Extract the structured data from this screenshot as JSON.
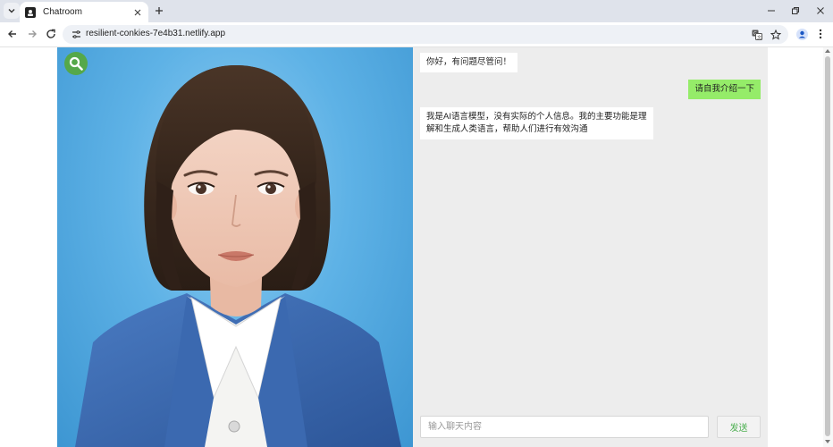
{
  "browser": {
    "tab_title": "Chatroom",
    "url": "resilient-conkies-7e4b31.netlify.app",
    "icons": [
      "tab-search-icon",
      "favicon-icon",
      "close-icon",
      "plus-icon",
      "minimize-icon",
      "restore-icon",
      "close-window-icon",
      "back-icon",
      "forward-icon",
      "reload-icon",
      "site-info-icon",
      "translate-icon",
      "star-icon",
      "profile-icon",
      "kebab-menu-icon"
    ]
  },
  "chat": {
    "messages": [
      {
        "role": "bot",
        "text": "你好，有问题尽管问！"
      },
      {
        "role": "user",
        "text": "请自我介绍一下"
      },
      {
        "role": "bot",
        "text": "我是AI语言模型，没有实际的个人信息。我的主要功能是理\n解和生成人类语言，帮助人们进行有效沟通"
      }
    ],
    "input_placeholder": "输入聊天内容",
    "input_value": "",
    "send_label": "发送"
  },
  "colors": {
    "user_bubble": "#95ec69",
    "bot_bubble": "#ffffff",
    "chat_bg": "#ededed",
    "search_button": "#55a84a",
    "avatar_bg": "#5eb2e6"
  }
}
